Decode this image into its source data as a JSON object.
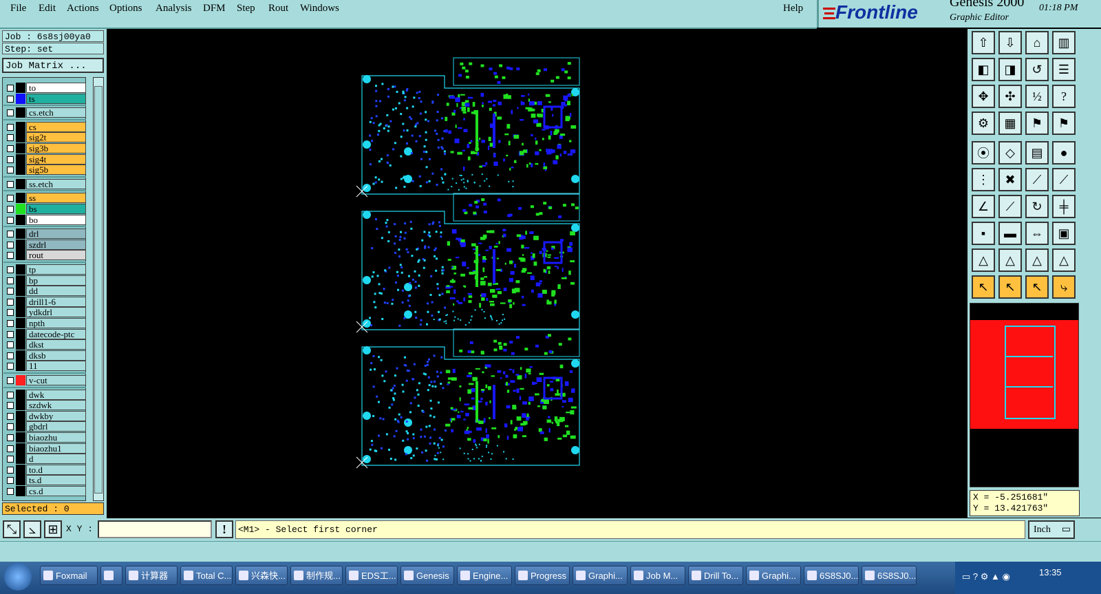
{
  "menubar": {
    "items": [
      "File",
      "Edit",
      "Actions",
      "Options",
      "Analysis",
      "DFM",
      "Step",
      "Rout",
      "Windows"
    ],
    "help": "Help"
  },
  "brand": {
    "logo": "Frontline",
    "product": "Genesis 2000",
    "subtitle": "Graphic Editor",
    "time": "01:18 PM"
  },
  "job": {
    "job_label": "Job : 6s8sj00ya0",
    "step_label": "Step: set",
    "matrix_button": "Job Matrix ..."
  },
  "layers": [
    {
      "name": "to",
      "color": "#ffffff",
      "swatch": "#000000"
    },
    {
      "name": "ts",
      "color": "#20b0a0",
      "swatch": "#1010ff"
    },
    {
      "name": "cs.etch",
      "color": "#a8dcdc",
      "swatch": "#000000"
    },
    {
      "name": "cs",
      "color": "#ffc040",
      "swatch": "#000000"
    },
    {
      "name": "sig2t",
      "color": "#ffc040",
      "swatch": "#000000"
    },
    {
      "name": "sig3b",
      "color": "#ffc040",
      "swatch": "#000000"
    },
    {
      "name": "sig4t",
      "color": "#ffc040",
      "swatch": "#000000"
    },
    {
      "name": "sig5b",
      "color": "#ffc040",
      "swatch": "#000000"
    },
    {
      "name": "ss.etch",
      "color": "#a8dcdc",
      "swatch": "#000000"
    },
    {
      "name": "ss",
      "color": "#ffc040",
      "swatch": "#000000"
    },
    {
      "name": "bs",
      "color": "#20b0a0",
      "swatch": "#20e020"
    },
    {
      "name": "bo",
      "color": "#ffffff",
      "swatch": "#000000"
    },
    {
      "name": "drl",
      "color": "#90b8c0",
      "swatch": "#000000"
    },
    {
      "name": "szdrl",
      "color": "#90b8c0",
      "swatch": "#000000"
    },
    {
      "name": "rout",
      "color": "#d8d8d8",
      "swatch": "#000000"
    },
    {
      "name": "tp",
      "color": "#a8dcdc",
      "swatch": "#000000"
    },
    {
      "name": "bp",
      "color": "#a8dcdc",
      "swatch": "#000000"
    },
    {
      "name": "dd",
      "color": "#a8dcdc",
      "swatch": "#000000"
    },
    {
      "name": "drill1-6",
      "color": "#a8dcdc",
      "swatch": "#000000"
    },
    {
      "name": "ydkdrl",
      "color": "#a8dcdc",
      "swatch": "#000000"
    },
    {
      "name": "npth",
      "color": "#a8dcdc",
      "swatch": "#000000"
    },
    {
      "name": "datecode-ptc",
      "color": "#a8dcdc",
      "swatch": "#000000"
    },
    {
      "name": "dkst",
      "color": "#a8dcdc",
      "swatch": "#000000"
    },
    {
      "name": "dksb",
      "color": "#a8dcdc",
      "swatch": "#000000"
    },
    {
      "name": "11",
      "color": "#a8dcdc",
      "swatch": "#000000"
    },
    {
      "name": "v-cut",
      "color": "#a8dcdc",
      "swatch": "#ff2020"
    },
    {
      "name": "dwk",
      "color": "#a8dcdc",
      "swatch": "#000000"
    },
    {
      "name": "szdwk",
      "color": "#a8dcdc",
      "swatch": "#000000"
    },
    {
      "name": "dwkby",
      "color": "#a8dcdc",
      "swatch": "#000000"
    },
    {
      "name": "gbdrl",
      "color": "#a8dcdc",
      "swatch": "#000000"
    },
    {
      "name": "biaozhu",
      "color": "#a8dcdc",
      "swatch": "#000000"
    },
    {
      "name": "biaozhu1",
      "color": "#a8dcdc",
      "swatch": "#000000"
    },
    {
      "name": "d",
      "color": "#a8dcdc",
      "swatch": "#000000"
    },
    {
      "name": "to.d",
      "color": "#a8dcdc",
      "swatch": "#000000"
    },
    {
      "name": "ts.d",
      "color": "#a8dcdc",
      "swatch": "#000000"
    },
    {
      "name": "cs.d",
      "color": "#a8dcdc",
      "swatch": "#000000"
    }
  ],
  "selected": "Selected : 0",
  "coords": {
    "x": "X = -5.251681\"",
    "y": "Y = 13.421763\""
  },
  "bottom": {
    "xy_label": "X Y :",
    "xy_value": "",
    "prompt": "<M1> - Select first corner",
    "units": "Inch"
  },
  "taskbar": {
    "items": [
      "Foxmail",
      "",
      "计算器",
      "Total C...",
      "兴森快...",
      "制作规...",
      "EDS工...",
      "Genesis",
      "Engine...",
      "Progress",
      "Graphi...",
      "Job M...",
      "Drill To...",
      "Graphi...",
      "6S8SJ0...",
      "6S8SJ0..."
    ],
    "clock": "13:35"
  }
}
